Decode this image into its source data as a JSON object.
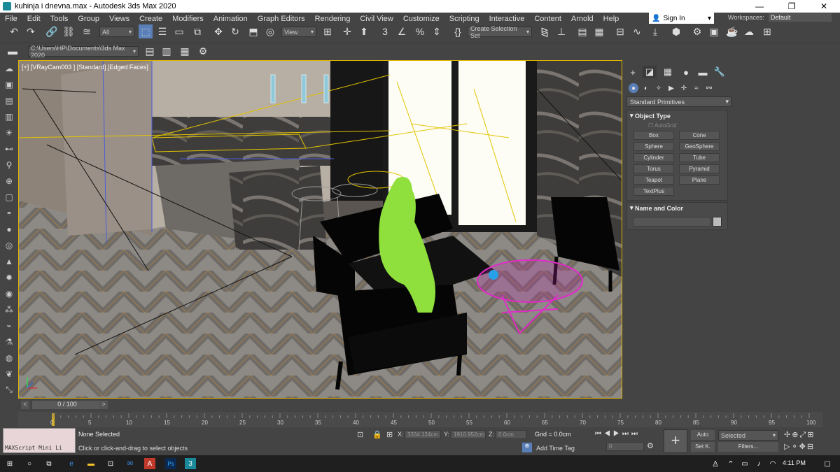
{
  "window": {
    "title": "kuhinja i dnevna.max - Autodesk 3ds Max 2020",
    "minimize": "—",
    "maximize": "❐",
    "close": "✕"
  },
  "menu": [
    "File",
    "Edit",
    "Tools",
    "Group",
    "Views",
    "Create",
    "Modifiers",
    "Animation",
    "Graph Editors",
    "Rendering",
    "Civil View",
    "Customize",
    "Scripting",
    "Interactive",
    "Content",
    "Arnold",
    "Help"
  ],
  "signin": "Sign In",
  "workspaces": {
    "label": "Workspaces:",
    "value": "Default"
  },
  "toolbar": {
    "filter": "All",
    "ref_coord": "View",
    "selection_set": "Create Selection Set",
    "project_path": "C:\\Users\\HP\\Documents\\3ds Max 2020"
  },
  "viewport": {
    "label": "[+] [VRayCam003 ] [Standard] [Edged Faces]"
  },
  "command_panel": {
    "category": "Standard Primitives",
    "object_type_title": "Object Type",
    "autogrid": "AutoGrid",
    "primitives": [
      "Box",
      "Cone",
      "Sphere",
      "GeoSphere",
      "Cylinder",
      "Tube",
      "Torus",
      "Pyramid",
      "Teapot",
      "Plane",
      "TextPlus"
    ],
    "name_color_title": "Name and Color"
  },
  "timeline": {
    "frame": "0 / 100",
    "prev": "<",
    "next": ">",
    "ticks": [
      "0",
      "5",
      "10",
      "15",
      "20",
      "25",
      "30",
      "35",
      "40",
      "45",
      "50",
      "55",
      "60",
      "65",
      "70",
      "75",
      "80",
      "85",
      "90",
      "95",
      "100"
    ]
  },
  "status": {
    "maxscript": "MAXScript Mini Li",
    "selection": "None Selected",
    "prompt": "Click or click-and-drag to select objects",
    "x_label": "X:",
    "x_value": "3334.124cm",
    "y_label": "Y:",
    "y_value": "1910.952cm",
    "z_label": "Z:",
    "z_value": "0.0cm",
    "grid": "Grid = 0.0cm",
    "add_time_tag": "Add Time Tag",
    "auto_key": "Auto",
    "set_key": "Set K.",
    "key_mode": "Selected",
    "filters": "Filters...",
    "current_frame": "0"
  },
  "taskbar": {
    "time": "4:11 PM"
  },
  "colors": {
    "accent": "#e0b400",
    "active_tab": "#5a7fb8"
  }
}
